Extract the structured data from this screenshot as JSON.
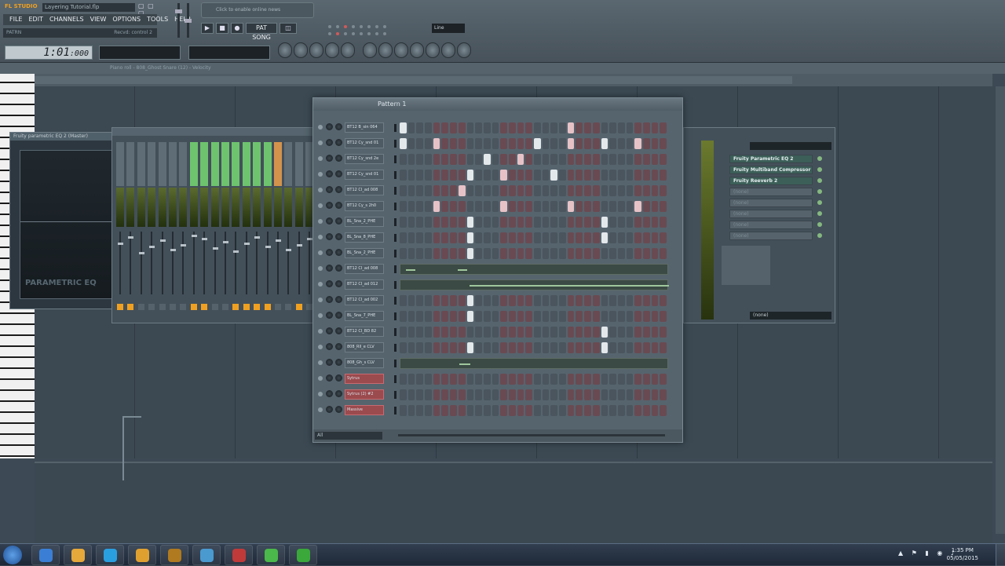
{
  "app": {
    "logo": "FL STUDIO",
    "file_title": "Layering Tutorial.flp",
    "window_buttons": "▢ ▢ ▢",
    "menu": [
      "FILE",
      "EDIT",
      "CHANNELS",
      "VIEW",
      "OPTIONS",
      "TOOLS",
      "HELP"
    ],
    "hint_left": "PATRN",
    "hint_right": "Recvd: control 2",
    "hint_panel": "Click to enable online news",
    "pat_song": "PAT SONG",
    "tempo_label": "Line",
    "time_display": "1:01",
    "time_small": ":000",
    "piano_roll_title": "Piano roll - 808_Ghost Snare (12) - Velocity"
  },
  "mixer": {
    "strips": [
      {
        "type": "normal",
        "led": "on"
      },
      {
        "type": "normal",
        "led": "on"
      },
      {
        "type": "normal",
        "led": "off"
      },
      {
        "type": "normal",
        "led": "off"
      },
      {
        "type": "normal",
        "led": "off"
      },
      {
        "type": "normal",
        "led": "off"
      },
      {
        "type": "normal",
        "led": "off"
      },
      {
        "type": "green",
        "led": "on"
      },
      {
        "type": "green",
        "led": "on"
      },
      {
        "type": "green",
        "led": "off"
      },
      {
        "type": "green",
        "led": "off"
      },
      {
        "type": "green",
        "led": "on"
      },
      {
        "type": "green",
        "led": "on"
      },
      {
        "type": "green",
        "led": "on"
      },
      {
        "type": "green",
        "led": "on"
      },
      {
        "type": "orange",
        "led": "off"
      },
      {
        "type": "normal",
        "led": "off"
      },
      {
        "type": "normal",
        "led": "on"
      },
      {
        "type": "normal",
        "led": "off"
      }
    ]
  },
  "eq_window": {
    "title": "Fruity parametric EQ 2 (Master)",
    "label": "PARAMETRIC EQ"
  },
  "fx": {
    "slots": [
      "Fruity Parametric EQ 2",
      "Fruity Multiband Compressor",
      "Fruity Reeverb 2",
      "(none)",
      "(none)",
      "(none)",
      "(none)",
      "(none)"
    ],
    "out": "(none)"
  },
  "sequencer": {
    "title": "Pattern 1",
    "rows": [
      {
        "name": "BT12 B_sin 064",
        "red": false,
        "kind": "steps",
        "on": [
          0,
          20
        ]
      },
      {
        "name": "BT12 Cy_snd 01",
        "red": false,
        "kind": "steps",
        "on": [
          0,
          4,
          16,
          20,
          24,
          28
        ]
      },
      {
        "name": "BT12 Cy_snd 2e",
        "red": false,
        "kind": "steps",
        "on": [
          10,
          14
        ]
      },
      {
        "name": "BT12 Cy_snd 01",
        "red": false,
        "kind": "steps",
        "on": [
          8,
          12,
          18
        ]
      },
      {
        "name": "BT12 CI_ad 008",
        "red": false,
        "kind": "steps",
        "on": [
          7
        ]
      },
      {
        "name": "BT12 Cy_s 2h0",
        "red": false,
        "kind": "steps",
        "on": [
          4,
          12,
          20,
          28
        ]
      },
      {
        "name": "BL_Sna_2_PHE",
        "red": false,
        "kind": "steps",
        "on": [
          8,
          24
        ]
      },
      {
        "name": "BL_Sna_8_PHE",
        "red": false,
        "kind": "steps",
        "on": [
          8,
          24
        ]
      },
      {
        "name": "BL_Sna_2_PHE",
        "red": false,
        "kind": "steps",
        "on": [
          8
        ]
      },
      {
        "name": "BT12 CI_ad 008",
        "red": false,
        "kind": "roll",
        "notes": [
          [
            7,
            12
          ],
          [
            73,
            12
          ]
        ]
      },
      {
        "name": "BT12 CI_ad 012",
        "red": false,
        "kind": "roll",
        "notes": [
          [
            88,
            254
          ]
        ]
      },
      {
        "name": "BT12 CI_ad 002",
        "red": false,
        "kind": "steps",
        "on": [
          8
        ]
      },
      {
        "name": "BL_Sna_7_PHE",
        "red": false,
        "kind": "steps",
        "on": [
          8
        ]
      },
      {
        "name": "BT12 CI_BD 82",
        "red": false,
        "kind": "steps",
        "on": [
          24
        ]
      },
      {
        "name": "808_Rll_e CLV",
        "red": false,
        "kind": "steps",
        "on": [
          8,
          24
        ]
      },
      {
        "name": "808_Gh_s CLV",
        "red": false,
        "kind": "roll",
        "notes": [
          [
            75,
            14
          ]
        ]
      },
      {
        "name": "Sytrus",
        "red": true,
        "kind": "steps",
        "on": []
      },
      {
        "name": "Sytrus (2) #2",
        "red": true,
        "kind": "steps",
        "on": []
      },
      {
        "name": "Massive",
        "red": true,
        "kind": "steps",
        "on": []
      }
    ],
    "filter": "All"
  },
  "taskbar": {
    "apps": [
      "ie",
      "chrome",
      "skype",
      "fl-studio",
      "winamp",
      "paint",
      "gear",
      "camtasia",
      "camtasia-recorder"
    ],
    "tray": "▲ ⚑ ▮ ◉ ♪",
    "time": "1:35 PM",
    "date": "05/05/2015"
  }
}
